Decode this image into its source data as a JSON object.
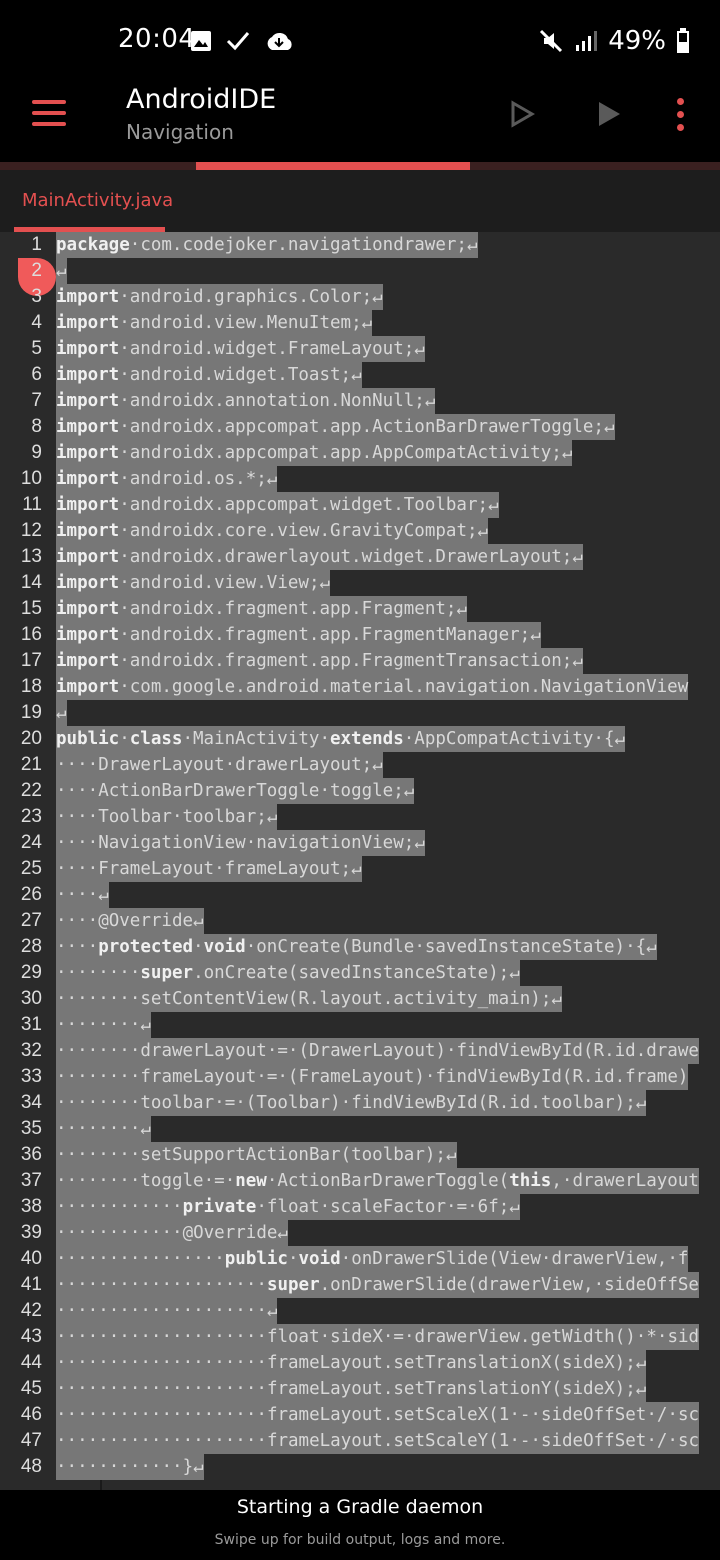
{
  "status_bar": {
    "time": "20:04",
    "battery": "49%",
    "left_icons": [
      "image-icon",
      "check-icon",
      "cloud-icon"
    ],
    "right_icons": [
      "mute-icon",
      "signal-icon",
      "battery-icon"
    ]
  },
  "app_bar": {
    "title": "AndroidIDE",
    "subtitle": "Navigation",
    "icons": [
      "menu-icon",
      "run-outline-icon",
      "run-icon",
      "more-vert-icon"
    ],
    "accent": "#e35050"
  },
  "build_progress": 0.38,
  "tabs": [
    {
      "label": "MainActivity.java",
      "active": true
    }
  ],
  "editor": {
    "line_numbers": [
      "1",
      "2",
      "3",
      "4",
      "5",
      "6",
      "7",
      "8",
      "9",
      "10",
      "11",
      "12",
      "13",
      "14",
      "15",
      "16",
      "17",
      "18",
      "19",
      "20",
      "21",
      "22",
      "23",
      "24",
      "25",
      "26",
      "27",
      "28",
      "29",
      "30",
      "31",
      "32",
      "33",
      "34",
      "35",
      "36",
      "37",
      "38",
      "39",
      "40",
      "41",
      "42",
      "43",
      "44",
      "45",
      "46",
      "47",
      "48"
    ],
    "lines": [
      "package·com.codejoker.navigationdrawer;↵",
      "↵",
      "import·android.graphics.Color;↵",
      "import·android.view.MenuItem;↵",
      "import·android.widget.FrameLayout;↵",
      "import·android.widget.Toast;↵",
      "import·androidx.annotation.NonNull;↵",
      "import·androidx.appcompat.app.ActionBarDrawerToggle;↵",
      "import·androidx.appcompat.app.AppCompatActivity;↵",
      "import·android.os.*;↵",
      "import·androidx.appcompat.widget.Toolbar;↵",
      "import·androidx.core.view.GravityCompat;↵",
      "import·androidx.drawerlayout.widget.DrawerLayout;↵",
      "import·android.view.View;↵",
      "import·androidx.fragment.app.Fragment;↵",
      "import·androidx.fragment.app.FragmentManager;↵",
      "import·androidx.fragment.app.FragmentTransaction;↵",
      "import·com.google.android.material.navigation.NavigationView",
      "↵",
      "public·class·MainActivity·extends·AppCompatActivity·{↵",
      "····DrawerLayout·drawerLayout;↵",
      "····ActionBarDrawerToggle·toggle;↵",
      "····Toolbar·toolbar;↵",
      "····NavigationView·navigationView;↵",
      "····FrameLayout·frameLayout;↵",
      "····↵",
      "····@Override↵",
      "····protected·void·onCreate(Bundle·savedInstanceState)·{↵",
      "········super.onCreate(savedInstanceState);↵",
      "········setContentView(R.layout.activity_main);↵",
      "········↵",
      "········drawerLayout·=·(DrawerLayout)·findViewById(R.id.drawe",
      "········frameLayout·=·(FrameLayout)·findViewById(R.id.frame)",
      "········toolbar·=·(Toolbar)·findViewById(R.id.toolbar);↵",
      "········↵",
      "········setSupportActionBar(toolbar);↵",
      "········toggle·=·new·ActionBarDrawerToggle(this,·drawerLayout",
      "············private·float·scaleFactor·=·6f;↵",
      "············@Override↵",
      "················public·void·onDrawerSlide(View·drawerView,·f",
      "····················super.onDrawerSlide(drawerView,·sideOffSe",
      "····················↵",
      "····················float·sideX·=·drawerView.getWidth()·*·sid",
      "····················frameLayout.setTranslationX(sideX);↵",
      "····················frameLayout.setTranslationY(sideX);↵",
      "····················frameLayout.setScaleX(1·-·sideOffSet·/·sc",
      "····················frameLayout.setScaleY(1·-·sideOffSet·/·sc",
      "············}↵"
    ],
    "background": "#2a2a2a",
    "selection": "#777777"
  },
  "bottom": {
    "title": "Starting a Gradle daemon",
    "hint": "Swipe up for build output, logs and more."
  }
}
